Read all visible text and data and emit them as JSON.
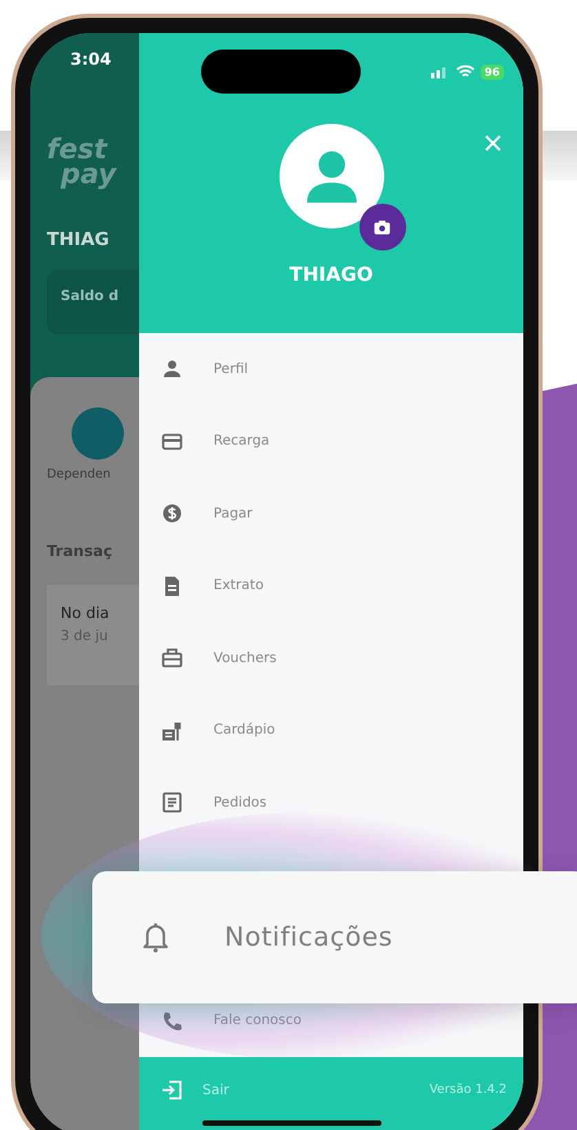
{
  "status_bar": {
    "time": "3:04",
    "battery": "96"
  },
  "background_screen": {
    "logo": [
      "fest",
      "pay"
    ],
    "user": "THIAG",
    "balance_label": "Saldo d",
    "shortcut": "Dependen",
    "section": "Transaç",
    "transaction": {
      "title": "No dia",
      "date": "3 de ju"
    }
  },
  "drawer": {
    "user_name": "THIAGO",
    "menu": [
      {
        "kind": "person",
        "label": "Perfil"
      },
      {
        "kind": "card",
        "label": "Recarga"
      },
      {
        "kind": "coin",
        "label": "Pagar"
      },
      {
        "kind": "document",
        "label": "Extrato"
      },
      {
        "kind": "ticket",
        "label": "Vouchers"
      },
      {
        "kind": "menu",
        "label": "Cardápio"
      },
      {
        "kind": "list",
        "label": "Pedidos"
      },
      {
        "kind": "phone",
        "label": "Fale conosco"
      }
    ],
    "footer": {
      "logout": "Sair",
      "version": "Versão 1.4.2"
    }
  },
  "highlight_card": {
    "label": "Notificações"
  }
}
